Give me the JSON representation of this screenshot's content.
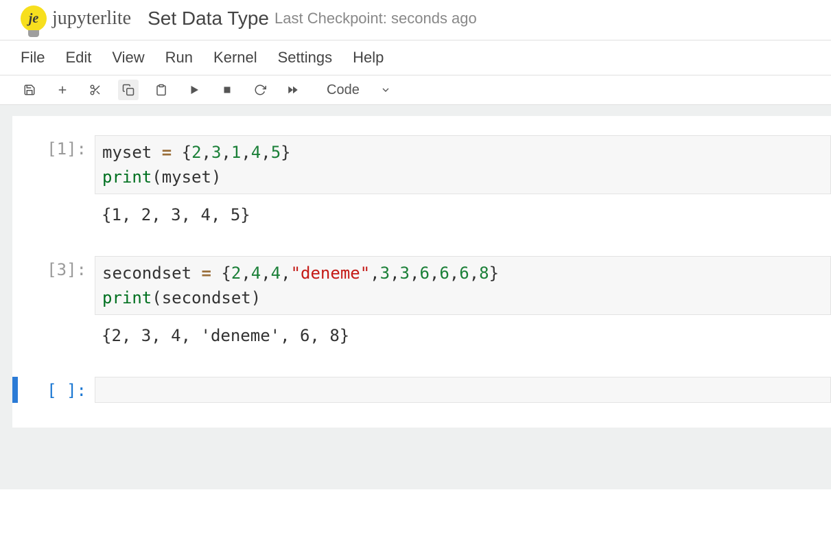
{
  "header": {
    "logo_glyph": "je",
    "logo_text": "jupyterlite",
    "title": "Set Data Type",
    "checkpoint": "Last Checkpoint: seconds ago"
  },
  "menu": [
    "File",
    "Edit",
    "View",
    "Run",
    "Kernel",
    "Settings",
    "Help"
  ],
  "toolbar": {
    "cell_type": "Code"
  },
  "cells": [
    {
      "prompt": "[1]:",
      "code_tokens": [
        {
          "t": "myset ",
          "c": ""
        },
        {
          "t": "=",
          "c": "tk-op"
        },
        {
          "t": " {",
          "c": ""
        },
        {
          "t": "2",
          "c": "tk-num"
        },
        {
          "t": ",",
          "c": ""
        },
        {
          "t": "3",
          "c": "tk-num"
        },
        {
          "t": ",",
          "c": ""
        },
        {
          "t": "1",
          "c": "tk-num"
        },
        {
          "t": ",",
          "c": ""
        },
        {
          "t": "4",
          "c": "tk-num"
        },
        {
          "t": ",",
          "c": ""
        },
        {
          "t": "5",
          "c": "tk-num"
        },
        {
          "t": "}",
          "c": ""
        },
        {
          "t": "\n",
          "c": ""
        },
        {
          "t": "print",
          "c": "tk-fn"
        },
        {
          "t": "(myset)",
          "c": ""
        }
      ],
      "output": "{1, 2, 3, 4, 5}",
      "selected": false
    },
    {
      "prompt": "[3]:",
      "code_tokens": [
        {
          "t": "secondset ",
          "c": ""
        },
        {
          "t": "=",
          "c": "tk-op"
        },
        {
          "t": " {",
          "c": ""
        },
        {
          "t": "2",
          "c": "tk-num"
        },
        {
          "t": ",",
          "c": ""
        },
        {
          "t": "4",
          "c": "tk-num"
        },
        {
          "t": ",",
          "c": ""
        },
        {
          "t": "4",
          "c": "tk-num"
        },
        {
          "t": ",",
          "c": ""
        },
        {
          "t": "\"deneme\"",
          "c": "tk-str"
        },
        {
          "t": ",",
          "c": ""
        },
        {
          "t": "3",
          "c": "tk-num"
        },
        {
          "t": ",",
          "c": ""
        },
        {
          "t": "3",
          "c": "tk-num"
        },
        {
          "t": ",",
          "c": ""
        },
        {
          "t": "6",
          "c": "tk-num"
        },
        {
          "t": ",",
          "c": ""
        },
        {
          "t": "6",
          "c": "tk-num"
        },
        {
          "t": ",",
          "c": ""
        },
        {
          "t": "6",
          "c": "tk-num"
        },
        {
          "t": ",",
          "c": ""
        },
        {
          "t": "8",
          "c": "tk-num"
        },
        {
          "t": "}",
          "c": ""
        },
        {
          "t": "\n",
          "c": ""
        },
        {
          "t": "print",
          "c": "tk-fn"
        },
        {
          "t": "(secondset)",
          "c": ""
        }
      ],
      "output": "{2, 3, 4, 'deneme', 6, 8}",
      "selected": false
    },
    {
      "prompt": "[ ]:",
      "code_tokens": [],
      "output": "",
      "selected": true
    }
  ]
}
